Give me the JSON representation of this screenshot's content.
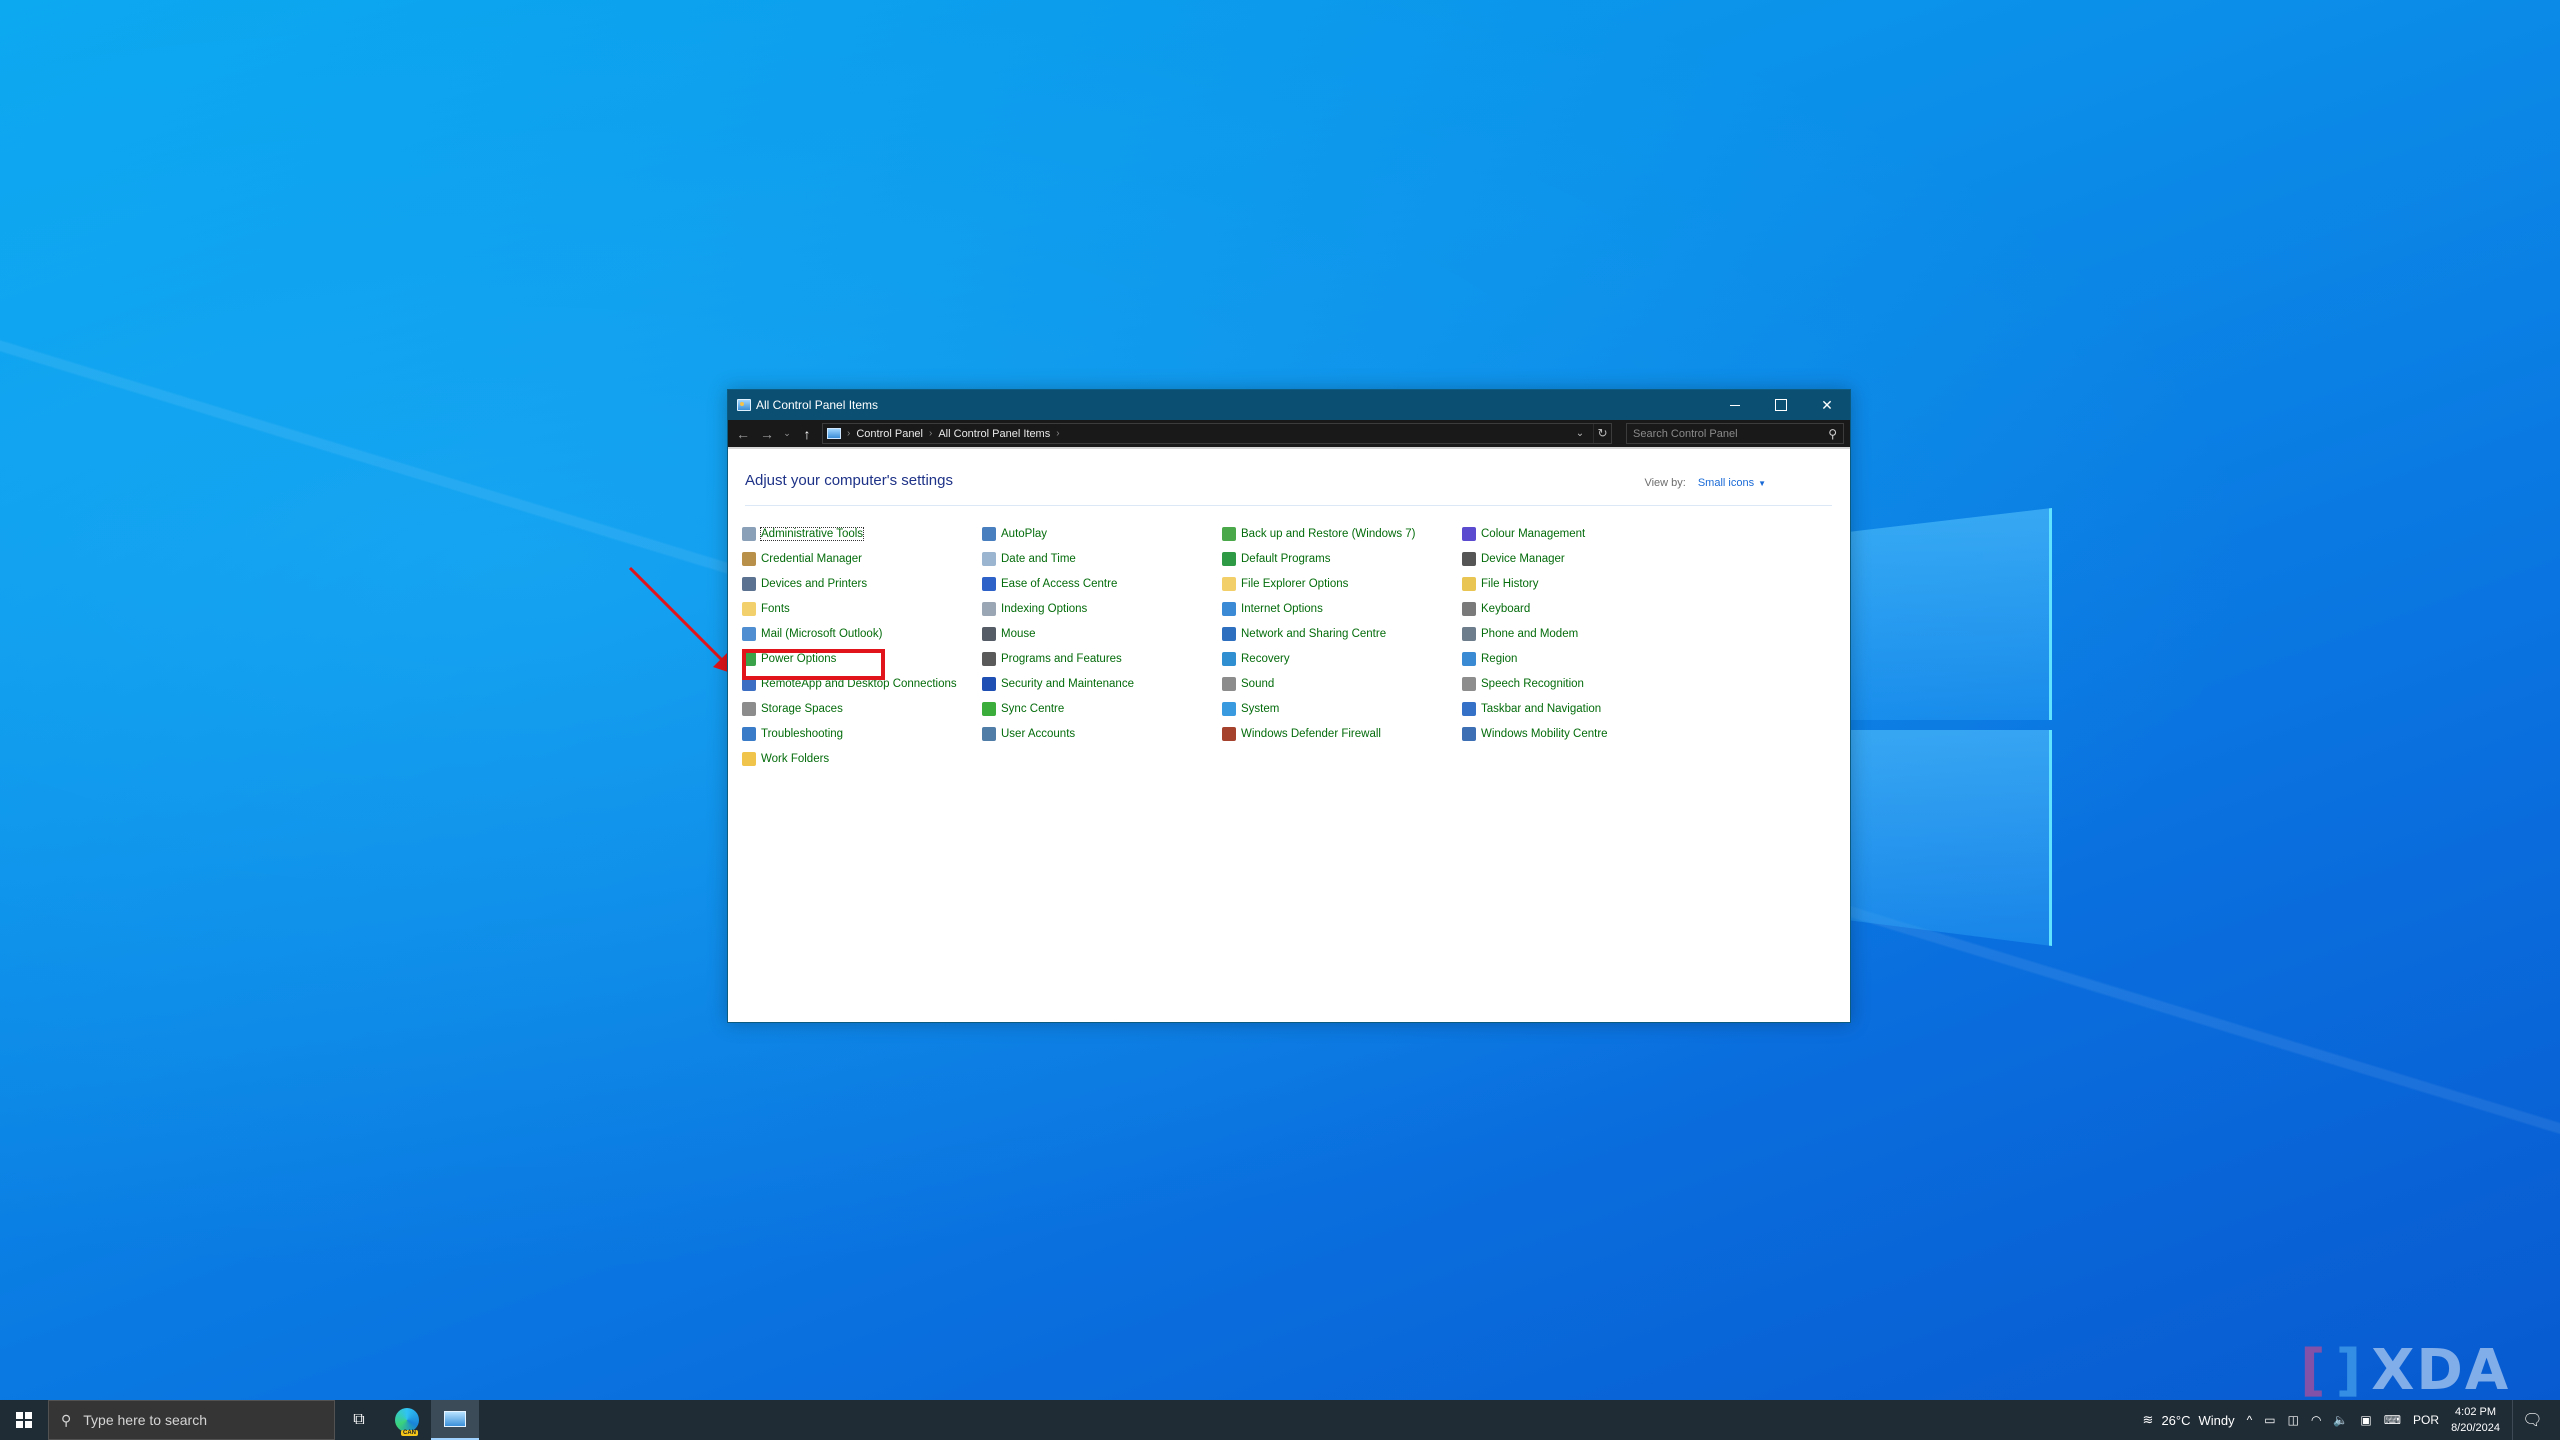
{
  "window": {
    "title": "All Control Panel Items",
    "controls": {
      "minimize": "",
      "maximize": "",
      "close": "✕"
    }
  },
  "addressbar": {
    "back": "←",
    "forward": "→",
    "recent": "⌄",
    "up": "↑",
    "breadcrumb": [
      "Control Panel",
      "All Control Panel Items"
    ],
    "separator": "›",
    "dropdown": "⌄",
    "refresh": "↻",
    "search_placeholder": "Search Control Panel",
    "search_icon": "⚲"
  },
  "content": {
    "heading": "Adjust your computer's settings",
    "view_by_label": "View by:",
    "view_by_value": "Small icons",
    "view_by_caret": "▼",
    "columns": [
      [
        {
          "label": "Administrative Tools",
          "icon": "admin-tools-icon",
          "color": "#8aa0b8",
          "focused": true
        },
        {
          "label": "Credential Manager",
          "icon": "credential-icon",
          "color": "#b8904a"
        },
        {
          "label": "Devices and Printers",
          "icon": "printer-icon",
          "color": "#5b7290"
        },
        {
          "label": "Fonts",
          "icon": "fonts-icon",
          "color": "#f2d06b"
        },
        {
          "label": "Mail (Microsoft Outlook)",
          "icon": "mail-icon",
          "color": "#4f8fd1"
        },
        {
          "label": "Power Options",
          "icon": "power-icon",
          "color": "#3aa34a",
          "highlighted": true
        },
        {
          "label": "RemoteApp and Desktop Connections",
          "icon": "remoteapp-icon",
          "color": "#3c6fc4"
        },
        {
          "label": "Storage Spaces",
          "icon": "storage-icon",
          "color": "#8c8c8c"
        },
        {
          "label": "Troubleshooting",
          "icon": "troubleshooting-icon",
          "color": "#3b7cc9"
        },
        {
          "label": "Work Folders",
          "icon": "work-folders-icon",
          "color": "#f0c34a"
        }
      ],
      [
        {
          "label": "AutoPlay",
          "icon": "autoplay-icon",
          "color": "#4a7fbf"
        },
        {
          "label": "Date and Time",
          "icon": "clock-icon",
          "color": "#9bb4cf"
        },
        {
          "label": "Ease of Access Centre",
          "icon": "ease-of-access-icon",
          "color": "#2e62c9"
        },
        {
          "label": "Indexing Options",
          "icon": "indexing-icon",
          "color": "#9aa6b3"
        },
        {
          "label": "Mouse",
          "icon": "mouse-icon",
          "color": "#555c66"
        },
        {
          "label": "Programs and Features",
          "icon": "programs-icon",
          "color": "#5a5a5a"
        },
        {
          "label": "Security and Maintenance",
          "icon": "flag-icon",
          "color": "#1f4fb3"
        },
        {
          "label": "Sync Centre",
          "icon": "sync-icon",
          "color": "#3aad3a"
        },
        {
          "label": "User Accounts",
          "icon": "users-icon",
          "color": "#4f7da8"
        }
      ],
      [
        {
          "label": "Back up and Restore (Windows 7)",
          "icon": "backup-icon",
          "color": "#4aa84a"
        },
        {
          "label": "Default Programs",
          "icon": "default-programs-icon",
          "color": "#2e9a46"
        },
        {
          "label": "File Explorer Options",
          "icon": "folder-options-icon",
          "color": "#f3cf6a"
        },
        {
          "label": "Internet Options",
          "icon": "internet-options-icon",
          "color": "#3b8ad6"
        },
        {
          "label": "Network and Sharing Centre",
          "icon": "network-icon",
          "color": "#2f6fc0"
        },
        {
          "label": "Recovery",
          "icon": "recovery-icon",
          "color": "#2f8fd0"
        },
        {
          "label": "Sound",
          "icon": "speaker-icon",
          "color": "#8c8c8c"
        },
        {
          "label": "System",
          "icon": "monitor-icon",
          "color": "#3a9ae0"
        },
        {
          "label": "Windows Defender Firewall",
          "icon": "firewall-icon",
          "color": "#a4422e"
        }
      ],
      [
        {
          "label": "Colour Management",
          "icon": "colour-icon",
          "color": "#5a4bcf"
        },
        {
          "label": "Device Manager",
          "icon": "device-manager-icon",
          "color": "#555555"
        },
        {
          "label": "File History",
          "icon": "file-history-icon",
          "color": "#e9c553"
        },
        {
          "label": "Keyboard",
          "icon": "keyboard-icon",
          "color": "#7a7a7a"
        },
        {
          "label": "Phone and Modem",
          "icon": "phone-icon",
          "color": "#6d7d8c"
        },
        {
          "label": "Region",
          "icon": "globe-clock-icon",
          "color": "#3a8ad3"
        },
        {
          "label": "Speech Recognition",
          "icon": "microphone-icon",
          "color": "#8d8d8d"
        },
        {
          "label": "Taskbar and Navigation",
          "icon": "taskbar-icon",
          "color": "#3571c7"
        },
        {
          "label": "Windows Mobility Centre",
          "icon": "mobility-icon",
          "color": "#3d6fb5"
        }
      ]
    ]
  },
  "taskbar": {
    "search_placeholder": "Type here to search",
    "search_icon": "⚲",
    "task_view_icon": "⧉",
    "edge_badge": "CAN",
    "weather": {
      "temp": "26°C",
      "condition": "Windy"
    },
    "tray_icons": {
      "chevron": "^",
      "wifi": "◠",
      "volume": "🔈",
      "keyboard": "⌨"
    },
    "language": "POR",
    "time": "4:02 PM",
    "date": "8/20/2024",
    "notification_icon": "🗨"
  },
  "watermark": {
    "left": "[",
    "right": "]",
    "text": "XDA"
  },
  "colors": {
    "link_green": "#046c0b",
    "heading_blue": "#1e3287",
    "titlebar": "#0b4f72",
    "highlight_red": "#e0141a"
  }
}
